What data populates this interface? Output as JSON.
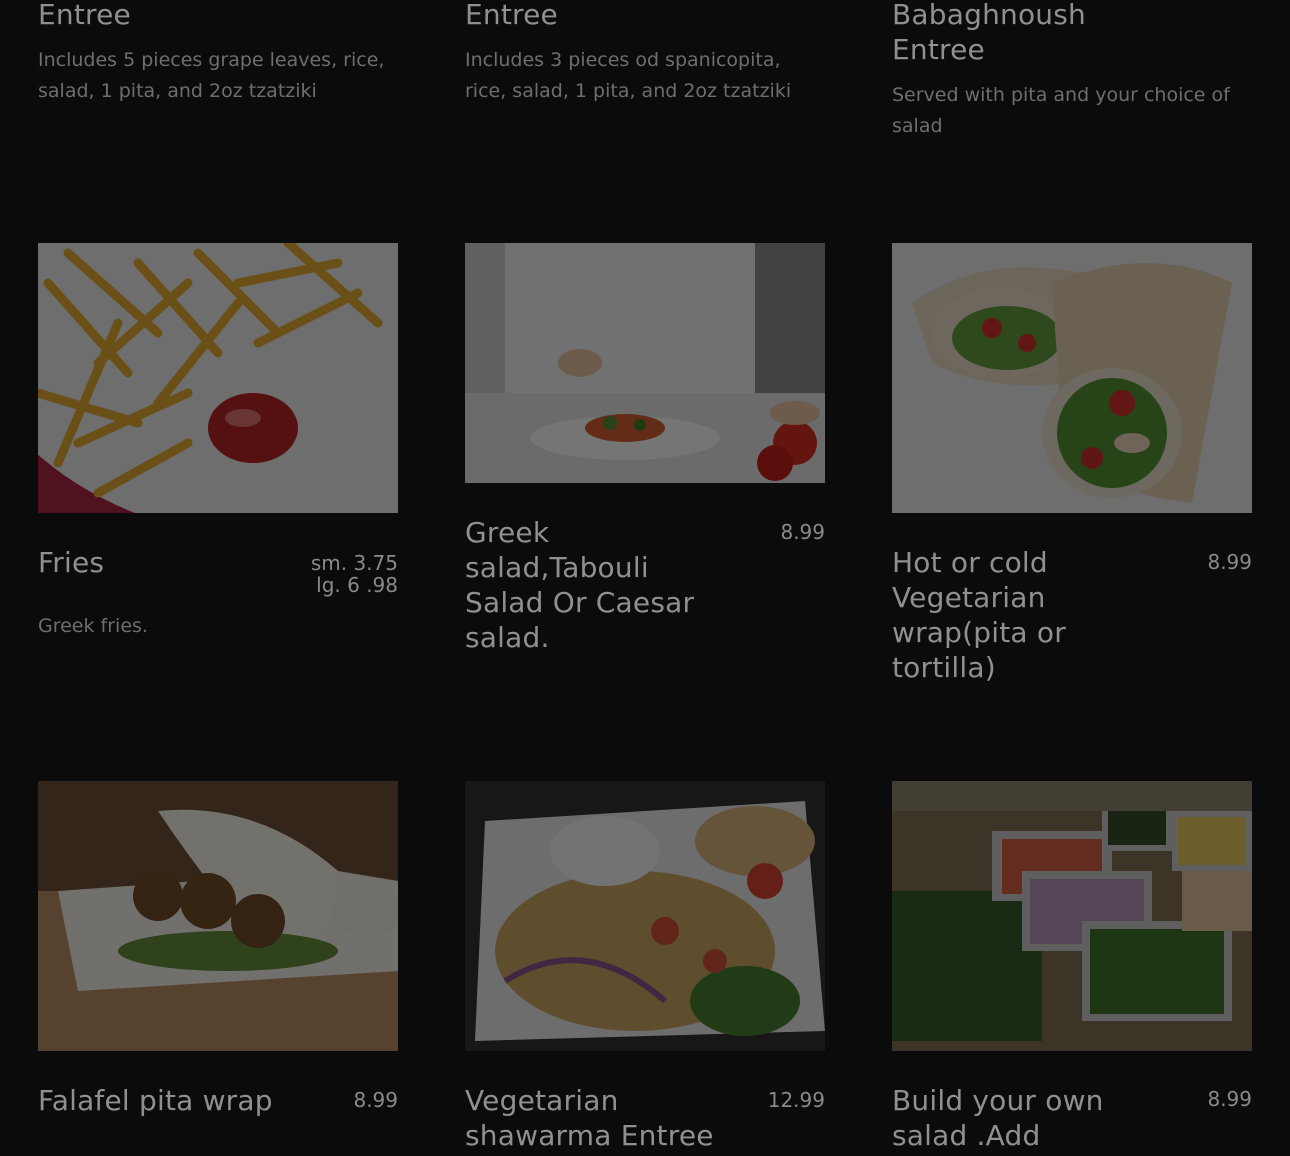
{
  "row1": [
    {
      "title": "Entree",
      "description": "Includes 5 pieces grape leaves, rice, salad, 1 pita, and 2oz tzatziki"
    },
    {
      "title": "Entree",
      "description": "Includes 3 pieces od spanicopita, rice, salad, 1 pita, and 2oz tzatziki"
    },
    {
      "title": "Babaghnoush Entree",
      "description": "Served with  pita and your choice of salad"
    }
  ],
  "row2": [
    {
      "title": "Fries",
      "price_line1": "sm. 3.75",
      "price_line2": "lg. 6 .98",
      "description": "Greek fries.",
      "image": "fries-with-ketchup"
    },
    {
      "title": "Greek salad,Tabouli Salad Or Caesar salad.",
      "price": "8.99",
      "image": "chef-plating-salad"
    },
    {
      "title": "Hot or cold Vegetarian wrap(pita or tortilla)",
      "price": "8.99",
      "image": "vegetarian-wrap"
    }
  ],
  "row3": [
    {
      "title": "Falafel pita wrap",
      "price": "8.99",
      "image": "falafel-pita"
    },
    {
      "title": "Vegetarian shawarma Entree",
      "price": "12.99",
      "image": "shawarma-plate"
    },
    {
      "title": "Build your own salad .Add",
      "price": "8.99",
      "image": "salad-bar"
    }
  ]
}
